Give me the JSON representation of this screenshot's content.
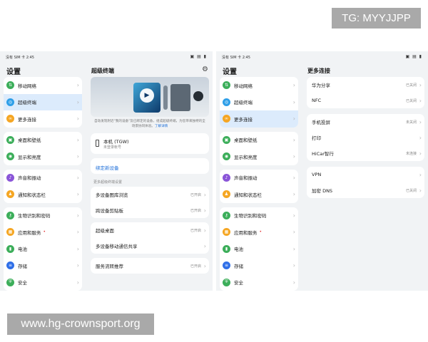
{
  "watermarks": {
    "top": "TG: MYYJJPP",
    "bottom": "www.hg-crownsport.org"
  },
  "status": {
    "carrier": "没有 SIM 卡 2:45",
    "icons": "▣ ▤ ▮"
  },
  "settings": {
    "title": "设置",
    "groups": [
      [
        {
          "label": "移动网络",
          "icon": "up-down-arrows-icon",
          "color": "#3cae5a",
          "glyph": "⇅"
        },
        {
          "label": "超级终端",
          "icon": "super-device-icon",
          "color": "#2f9fe8",
          "glyph": "◎"
        },
        {
          "label": "更多连接",
          "icon": "link-icon",
          "color": "#f5a623",
          "glyph": "∞"
        }
      ],
      [
        {
          "label": "桌面和壁纸",
          "icon": "wallpaper-icon",
          "color": "#3cae5a",
          "glyph": "▣"
        },
        {
          "label": "显示和亮度",
          "icon": "display-icon",
          "color": "#3cae5a",
          "glyph": "◉"
        }
      ],
      [
        {
          "label": "声音和振动",
          "icon": "sound-icon",
          "color": "#8a55d8",
          "glyph": "♪"
        },
        {
          "label": "通知和状态栏",
          "icon": "bell-icon",
          "color": "#f5a623",
          "glyph": "♟"
        }
      ],
      [
        {
          "label": "生物识别和密码",
          "icon": "key-icon",
          "color": "#3cae5a",
          "glyph": "⚷"
        },
        {
          "label": "应用和服务",
          "icon": "apps-icon",
          "color": "#f5a623",
          "glyph": "▦",
          "mark": "•"
        },
        {
          "label": "电池",
          "icon": "battery-icon",
          "color": "#3cae5a",
          "glyph": "▮"
        },
        {
          "label": "存储",
          "icon": "storage-icon",
          "color": "#2f6fe8",
          "glyph": "≡"
        },
        {
          "label": "安全",
          "icon": "shield-icon",
          "color": "#3cae5a",
          "glyph": "⛨"
        }
      ]
    ]
  },
  "super_device": {
    "title": "超级终端",
    "settings_icon": "gear-icon",
    "desc_text": "自动发现附近\"我的设备\"及已绑定的设备，组成超级终端，为您带来独特的全场景协同体验。",
    "desc_link": "了解详情",
    "device": {
      "name": "本机 (TGW)",
      "sub": "未登录帐号"
    },
    "bind_label": "绑定新设备",
    "more_settings_label": "更多超级终端设置",
    "groups": [
      [
        {
          "label": "多设备图库浏览",
          "value": "已开启"
        },
        {
          "label": "跨设备剪贴板",
          "value": "已开启"
        }
      ],
      [
        {
          "label": "超级桌面",
          "value": "已开启"
        },
        {
          "label": "多设备移动通信共享",
          "value": ""
        }
      ],
      [
        {
          "label": "服务流转推荐",
          "value": "已开启"
        }
      ]
    ]
  },
  "more_connections": {
    "title": "更多连接",
    "groups": [
      [
        {
          "label": "华为分享",
          "value": "已关闭"
        },
        {
          "label": "NFC",
          "value": "已关闭"
        }
      ],
      [
        {
          "label": "手机投屏",
          "value": "未关闭"
        },
        {
          "label": "打印",
          "value": ""
        },
        {
          "label": "HiCar智行",
          "value": "未连接"
        }
      ],
      [
        {
          "label": "VPN",
          "value": ""
        },
        {
          "label": "加密 DNS",
          "value": "已关闭"
        }
      ]
    ]
  },
  "colors": {
    "accent": "#1e6fd9",
    "selected": "#dcebfc",
    "background": "#f1f3f5"
  }
}
